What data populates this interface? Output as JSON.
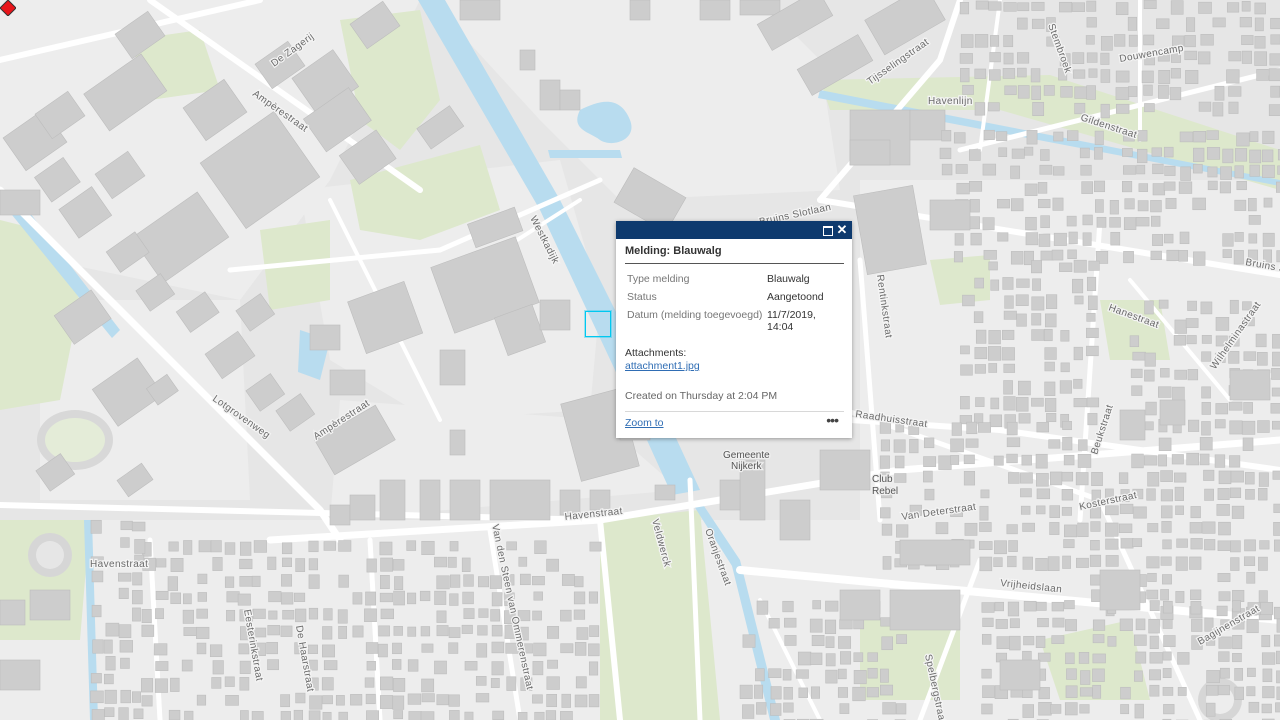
{
  "map": {
    "streets": {
      "ampere_1": "Ampèrestraat",
      "ampere_2": "Ampèrestraat",
      "zagerij": "De Zagerij",
      "westkadijk": "Westkadijk",
      "bruins_slotlaan": "Bruins Slotlaan",
      "bruins_2": "Bruins Sl",
      "tijsseling": "Tijsselingstraat",
      "havenlijn": "Havenlijn",
      "douwencamp": "Douwencamp",
      "gildenstraat": "Gildenstraat",
      "raadhuisstraat": "Raadhuisstraat",
      "havenstraat_1": "Havenstraat",
      "havenstraat_2": "Havenstraat",
      "van_den_steen": "Van den Steen van Ommerenstraat",
      "vrijheidslaan": "Vrijheidslaan",
      "van_deterstraat": "Van Deterstraat",
      "kosterstraat": "Kosterstraat",
      "oranjestraat": "Oranjestraat",
      "bagijnenstraat": "Bagijnenstraat",
      "hanestraat": "Hanestraat",
      "wilhelminastraat": "Wilhelminastraat",
      "beukstraat": "Beukstraat",
      "de_haarstraat": "De Haarstraat",
      "eesterinkstraat": "Eesterinkstraat",
      "spelbergstraat": "Spelbergstraat",
      "lotgrovenweg": "Lotgrovenweg",
      "stembroek": "Stembroek",
      "veldwerck": "Veldwerck",
      "rentinkstraat": "Rentinkstraat"
    },
    "pois": {
      "gemeente_1": "Gemeente",
      "gemeente_2": "Nijkerk",
      "club_1": "Club",
      "club_2": "Rebel"
    },
    "colors": {
      "background": "#e4e4e4",
      "building": "#cfcfcf",
      "water": "#b8dcef",
      "green": "#dfe8cf",
      "road": "#ffffff",
      "popup_header": "#0e3a6e",
      "marker": "#e8161b",
      "selection": "#00c8f0"
    }
  },
  "marker": {
    "icon": "red-diamond-icon"
  },
  "popup": {
    "title": "Melding: Blauwalg",
    "maximize_icon": "maximize-icon",
    "close_icon": "close-icon",
    "fields": [
      {
        "name": "Type melding",
        "value": "Blauwalg"
      },
      {
        "name": "Status",
        "value": "Aangetoond"
      },
      {
        "name": "Datum (melding toegevoegd)",
        "value": "11/7/2019, 14:04"
      }
    ],
    "attachments_label": "Attachments:",
    "attachment_name": "attachment1.jpg",
    "created_text": "Created on Thursday at 2:04 PM",
    "zoom_label": "Zoom to",
    "more_label": "•••"
  }
}
